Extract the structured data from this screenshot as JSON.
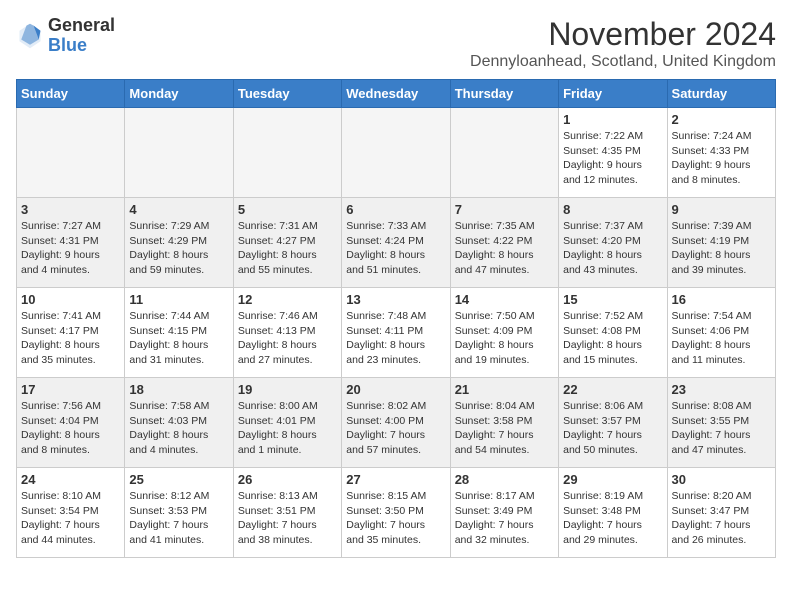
{
  "logo": {
    "general": "General",
    "blue": "Blue"
  },
  "title": "November 2024",
  "location": "Dennyloanhead, Scotland, United Kingdom",
  "headers": [
    "Sunday",
    "Monday",
    "Tuesday",
    "Wednesday",
    "Thursday",
    "Friday",
    "Saturday"
  ],
  "weeks": [
    [
      {
        "day": "",
        "info": "",
        "empty": true
      },
      {
        "day": "",
        "info": "",
        "empty": true
      },
      {
        "day": "",
        "info": "",
        "empty": true
      },
      {
        "day": "",
        "info": "",
        "empty": true
      },
      {
        "day": "",
        "info": "",
        "empty": true
      },
      {
        "day": "1",
        "info": "Sunrise: 7:22 AM\nSunset: 4:35 PM\nDaylight: 9 hours\nand 12 minutes.",
        "empty": false
      },
      {
        "day": "2",
        "info": "Sunrise: 7:24 AM\nSunset: 4:33 PM\nDaylight: 9 hours\nand 8 minutes.",
        "empty": false
      }
    ],
    [
      {
        "day": "3",
        "info": "Sunrise: 7:27 AM\nSunset: 4:31 PM\nDaylight: 9 hours\nand 4 minutes.",
        "empty": false
      },
      {
        "day": "4",
        "info": "Sunrise: 7:29 AM\nSunset: 4:29 PM\nDaylight: 8 hours\nand 59 minutes.",
        "empty": false
      },
      {
        "day": "5",
        "info": "Sunrise: 7:31 AM\nSunset: 4:27 PM\nDaylight: 8 hours\nand 55 minutes.",
        "empty": false
      },
      {
        "day": "6",
        "info": "Sunrise: 7:33 AM\nSunset: 4:24 PM\nDaylight: 8 hours\nand 51 minutes.",
        "empty": false
      },
      {
        "day": "7",
        "info": "Sunrise: 7:35 AM\nSunset: 4:22 PM\nDaylight: 8 hours\nand 47 minutes.",
        "empty": false
      },
      {
        "day": "8",
        "info": "Sunrise: 7:37 AM\nSunset: 4:20 PM\nDaylight: 8 hours\nand 43 minutes.",
        "empty": false
      },
      {
        "day": "9",
        "info": "Sunrise: 7:39 AM\nSunset: 4:19 PM\nDaylight: 8 hours\nand 39 minutes.",
        "empty": false
      }
    ],
    [
      {
        "day": "10",
        "info": "Sunrise: 7:41 AM\nSunset: 4:17 PM\nDaylight: 8 hours\nand 35 minutes.",
        "empty": false
      },
      {
        "day": "11",
        "info": "Sunrise: 7:44 AM\nSunset: 4:15 PM\nDaylight: 8 hours\nand 31 minutes.",
        "empty": false
      },
      {
        "day": "12",
        "info": "Sunrise: 7:46 AM\nSunset: 4:13 PM\nDaylight: 8 hours\nand 27 minutes.",
        "empty": false
      },
      {
        "day": "13",
        "info": "Sunrise: 7:48 AM\nSunset: 4:11 PM\nDaylight: 8 hours\nand 23 minutes.",
        "empty": false
      },
      {
        "day": "14",
        "info": "Sunrise: 7:50 AM\nSunset: 4:09 PM\nDaylight: 8 hours\nand 19 minutes.",
        "empty": false
      },
      {
        "day": "15",
        "info": "Sunrise: 7:52 AM\nSunset: 4:08 PM\nDaylight: 8 hours\nand 15 minutes.",
        "empty": false
      },
      {
        "day": "16",
        "info": "Sunrise: 7:54 AM\nSunset: 4:06 PM\nDaylight: 8 hours\nand 11 minutes.",
        "empty": false
      }
    ],
    [
      {
        "day": "17",
        "info": "Sunrise: 7:56 AM\nSunset: 4:04 PM\nDaylight: 8 hours\nand 8 minutes.",
        "empty": false
      },
      {
        "day": "18",
        "info": "Sunrise: 7:58 AM\nSunset: 4:03 PM\nDaylight: 8 hours\nand 4 minutes.",
        "empty": false
      },
      {
        "day": "19",
        "info": "Sunrise: 8:00 AM\nSunset: 4:01 PM\nDaylight: 8 hours\nand 1 minute.",
        "empty": false
      },
      {
        "day": "20",
        "info": "Sunrise: 8:02 AM\nSunset: 4:00 PM\nDaylight: 7 hours\nand 57 minutes.",
        "empty": false
      },
      {
        "day": "21",
        "info": "Sunrise: 8:04 AM\nSunset: 3:58 PM\nDaylight: 7 hours\nand 54 minutes.",
        "empty": false
      },
      {
        "day": "22",
        "info": "Sunrise: 8:06 AM\nSunset: 3:57 PM\nDaylight: 7 hours\nand 50 minutes.",
        "empty": false
      },
      {
        "day": "23",
        "info": "Sunrise: 8:08 AM\nSunset: 3:55 PM\nDaylight: 7 hours\nand 47 minutes.",
        "empty": false
      }
    ],
    [
      {
        "day": "24",
        "info": "Sunrise: 8:10 AM\nSunset: 3:54 PM\nDaylight: 7 hours\nand 44 minutes.",
        "empty": false
      },
      {
        "day": "25",
        "info": "Sunrise: 8:12 AM\nSunset: 3:53 PM\nDaylight: 7 hours\nand 41 minutes.",
        "empty": false
      },
      {
        "day": "26",
        "info": "Sunrise: 8:13 AM\nSunset: 3:51 PM\nDaylight: 7 hours\nand 38 minutes.",
        "empty": false
      },
      {
        "day": "27",
        "info": "Sunrise: 8:15 AM\nSunset: 3:50 PM\nDaylight: 7 hours\nand 35 minutes.",
        "empty": false
      },
      {
        "day": "28",
        "info": "Sunrise: 8:17 AM\nSunset: 3:49 PM\nDaylight: 7 hours\nand 32 minutes.",
        "empty": false
      },
      {
        "day": "29",
        "info": "Sunrise: 8:19 AM\nSunset: 3:48 PM\nDaylight: 7 hours\nand 29 minutes.",
        "empty": false
      },
      {
        "day": "30",
        "info": "Sunrise: 8:20 AM\nSunset: 3:47 PM\nDaylight: 7 hours\nand 26 minutes.",
        "empty": false
      }
    ]
  ]
}
